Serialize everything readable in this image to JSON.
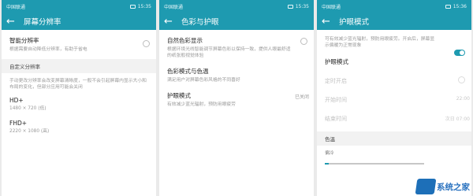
{
  "panels": [
    {
      "status": {
        "carrier": "中国联通",
        "time": "15:35"
      },
      "title": "屏幕分辨率",
      "smart": {
        "title": "智能分辨率",
        "desc": "根据需要自动降低分辨率，有助于省电"
      },
      "section": "自定义分辨率",
      "note": "手动更改分辨率会改变屏幕清晰度，一般不会引起屏幕内显示大小和布局的变化，但部分应用可能会关闭",
      "options": [
        {
          "label": "HD+",
          "detail": "1480 × 720 (低)"
        },
        {
          "label": "FHD+",
          "detail": "2220 × 1080 (高)"
        }
      ]
    },
    {
      "status": {
        "carrier": "中国联通",
        "time": "15:35"
      },
      "title": "色彩与护眼",
      "items": [
        {
          "title": "自然色彩显示",
          "desc": "根据环境光线智能调节屏幕色彩以保持一致，提供人眼最舒适的纸张般视觉体验"
        },
        {
          "title": "色彩模式与色温",
          "desc": "满足用户对屏幕色彩风格的不同喜好"
        },
        {
          "title": "护眼模式",
          "desc": "有效减少蓝光辐射，预防用眼疲劳",
          "value": "已关闭"
        }
      ]
    },
    {
      "status": {
        "carrier": "中国联通",
        "time": "15:36"
      },
      "title": "护眼模式",
      "intro": "可有效减少蓝光辐射，预防用眼疲劳。开启后，屏幕显示偏暖为正常现象",
      "toggle_label": "护眼模式",
      "schedule": {
        "label": "定时开启"
      },
      "start": {
        "label": "开始时间",
        "value": "22:00"
      },
      "end": {
        "label": "结束时间",
        "value": "次日 07:00"
      },
      "section": "色温",
      "temp_label": "偏冷",
      "temp_level": 0.04
    }
  ],
  "watermark": {
    "text": "系统之家"
  },
  "colors": {
    "accent": "#1e9ab0"
  }
}
